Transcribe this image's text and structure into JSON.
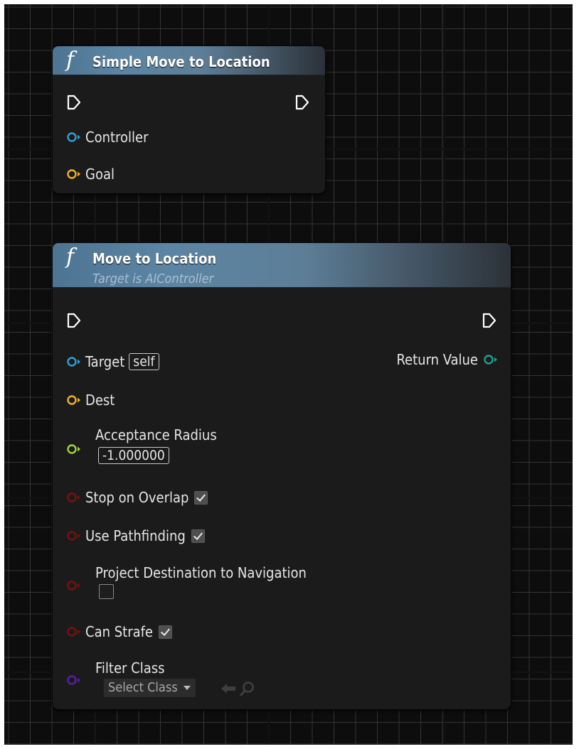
{
  "nodes": {
    "simple_move": {
      "title": "Simple Move to Location",
      "icon": "function-icon",
      "inputs": [
        {
          "label": "Controller",
          "pin_color": "#2f9fd6"
        },
        {
          "label": "Goal",
          "pin_color": "#f0b323"
        }
      ]
    },
    "move_to_location": {
      "title": "Move to Location",
      "subtitle": "Target is AIController",
      "icon": "function-icon",
      "target": {
        "label": "Target",
        "value": "self",
        "pin_color": "#2f9fd6"
      },
      "return_value": {
        "label": "Return Value",
        "pin_color": "#19a38f"
      },
      "dest": {
        "label": "Dest",
        "pin_color": "#f0b323"
      },
      "acceptance_radius": {
        "label": "Acceptance Radius",
        "value": "-1.000000",
        "pin_color": "#9ed735"
      },
      "stop_on_overlap": {
        "label": "Stop on Overlap",
        "checked": true,
        "pin_color": "#7a1010"
      },
      "use_pathfinding": {
        "label": "Use Pathfinding",
        "checked": true,
        "pin_color": "#7a1010"
      },
      "project_destination": {
        "label": "Project Destination to Navigation",
        "checked": false,
        "pin_color": "#7a1010"
      },
      "can_strafe": {
        "label": "Can Strafe",
        "checked": true,
        "pin_color": "#7a1010"
      },
      "filter_class": {
        "label": "Filter Class",
        "select_label": "Select Class",
        "pin_color": "#5a1ea8"
      }
    }
  },
  "icons": {
    "exec": "exec-pin-icon",
    "dropdown": "chevron-down-icon",
    "use_selected": "left-arrow-icon",
    "browse": "search-icon"
  }
}
